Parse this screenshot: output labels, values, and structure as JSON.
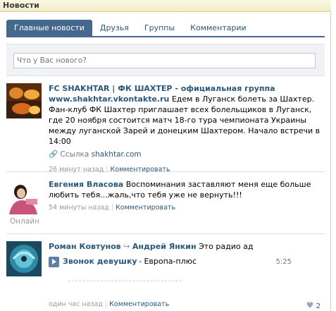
{
  "header": {
    "title": "Новости"
  },
  "tabs": [
    {
      "label": "Главные новости",
      "active": true
    },
    {
      "label": "Друзья"
    },
    {
      "label": "Группы"
    },
    {
      "label": "Комментарии"
    }
  ],
  "composer": {
    "placeholder": "Что у Вас нового?"
  },
  "posts": [
    {
      "author": "FC SHAKHTAR | ФК ШАХТЕР - официальная группа",
      "link_bold": "www.shakhtar.vkontakte.ru",
      "text_1": " Едем в Луганск болеть за Шахтер.",
      "text_2": "Фан-клуб ФК Шахтер приглашает всех болельщиков в Луганск, где 20 ноября состоится матч 18-го тура чемпионата Украины между луганской Зарей и донецким Шахтером. Начало встречи в 14:00",
      "link_label": "Ссылка",
      "link_domain": "shakhtar.com",
      "time": "26 минут назад",
      "comment": "Комментировать"
    },
    {
      "author": "Евгения Власова",
      "text": " Воспоминания заставляют меня еще больше любить тебя...жаль,что тебя уже не вернуть!!!",
      "time": "54 минуты назад",
      "comment": "Комментировать",
      "status": "Онлайн"
    },
    {
      "author": "Роман Ковтунов",
      "repost_to": "Андрей Янкин",
      "text": " Это радио ад",
      "audio": {
        "title": "Звонок девушку",
        "artist": "- Европа-плюс",
        "duration": "5:25"
      },
      "time": "один час назад",
      "comment": "Комментировать",
      "likes": "2"
    }
  ],
  "colors": {
    "accent": "#45688e",
    "link": "#2b587a"
  }
}
